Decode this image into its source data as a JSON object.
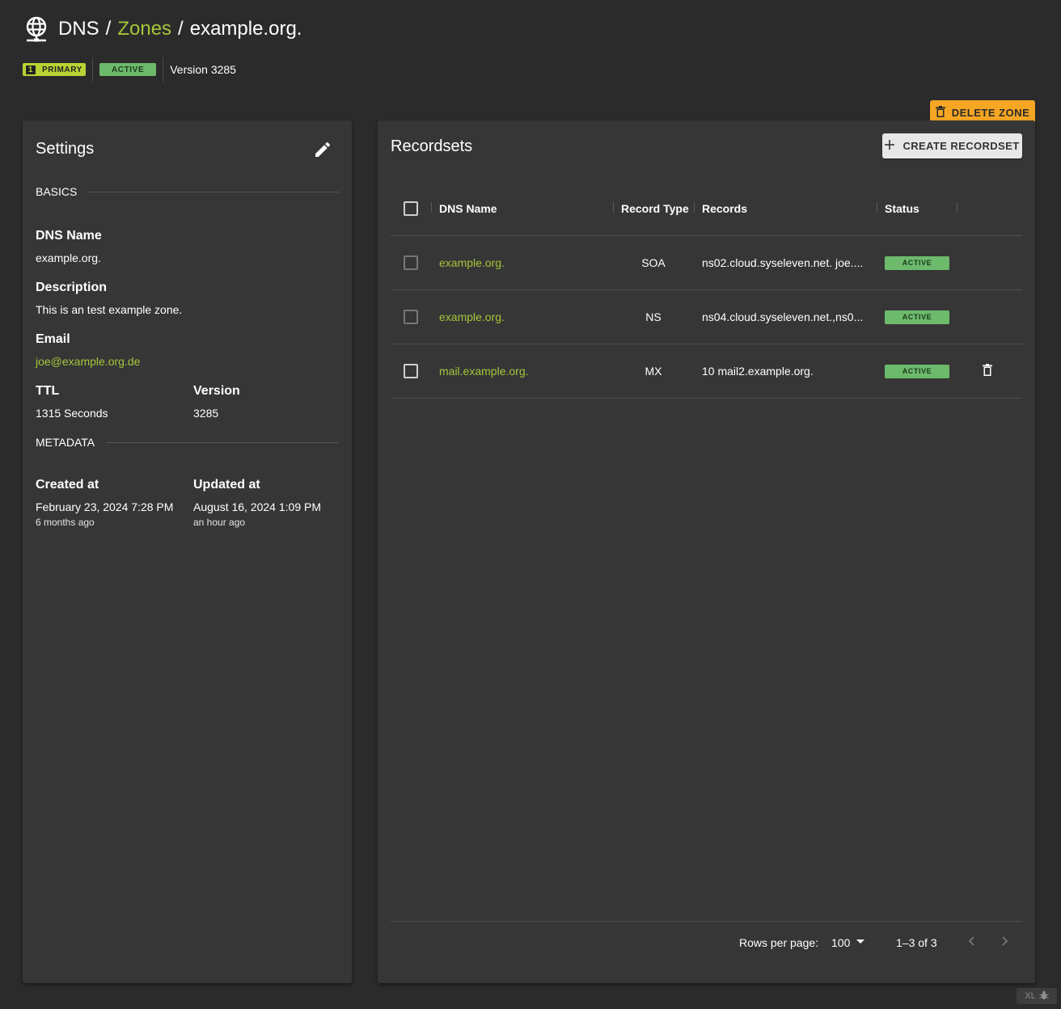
{
  "breadcrumb": {
    "items": [
      "DNS",
      "Zones",
      "example.org."
    ],
    "separator": "/"
  },
  "zone_meta": {
    "primary_number": "1",
    "primary_label": "PRIMARY",
    "status_label": "ACTIVE",
    "version_text": "Version 3285"
  },
  "actions": {
    "delete_zone_label": "DELETE ZONE",
    "create_recordset_label": "CREATE RECORDSET"
  },
  "settings": {
    "title": "Settings",
    "basics_label": "BASICS",
    "metadata_label": "METADATA",
    "dns_name_label": "DNS Name",
    "dns_name_value": "example.org.",
    "description_label": "Description",
    "description_value": "This is an test example zone.",
    "email_label": "Email",
    "email_value": "joe@example.org.de",
    "ttl_label": "TTL",
    "ttl_value": "1315 Seconds",
    "version_label": "Version",
    "version_value": "3285",
    "created_label": "Created at",
    "created_value": "February 23, 2024 7:28 PM",
    "created_relative": "6 months ago",
    "updated_label": "Updated at",
    "updated_value": "August 16, 2024 1:09 PM",
    "updated_relative": "an hour ago"
  },
  "recordsets": {
    "title": "Recordsets",
    "columns": [
      "DNS Name",
      "Record Type",
      "Records",
      "Status"
    ],
    "rows": [
      {
        "dns_name": "example.org.",
        "type": "SOA",
        "records": "ns02.cloud.syseleven.net. joe....",
        "status": "ACTIVE"
      },
      {
        "dns_name": "example.org.",
        "type": "NS",
        "records": "ns04.cloud.syseleven.net.,ns0...",
        "status": "ACTIVE"
      },
      {
        "dns_name": "mail.example.org.",
        "type": "MX",
        "records": "10 mail2.example.org.",
        "status": "ACTIVE"
      }
    ],
    "pagination": {
      "rows_per_page_label": "Rows per page:",
      "rows_per_page_value": "100",
      "range_text": "1–3 of 3"
    }
  },
  "debug_badge": "XL",
  "colors": {
    "background": "#2b2b2b",
    "panel": "#363636",
    "accent_link": "#a5c63b",
    "primary_chip": "#b9d334",
    "active_chip": "#6dba6c",
    "delete_button": "#f5a623"
  },
  "icons": [
    "globe-network-icon",
    "trash-icon",
    "pencil-icon",
    "plus-icon",
    "chevron-left-icon",
    "chevron-right-icon",
    "arrow-drop-down-icon",
    "bug-icon"
  ]
}
